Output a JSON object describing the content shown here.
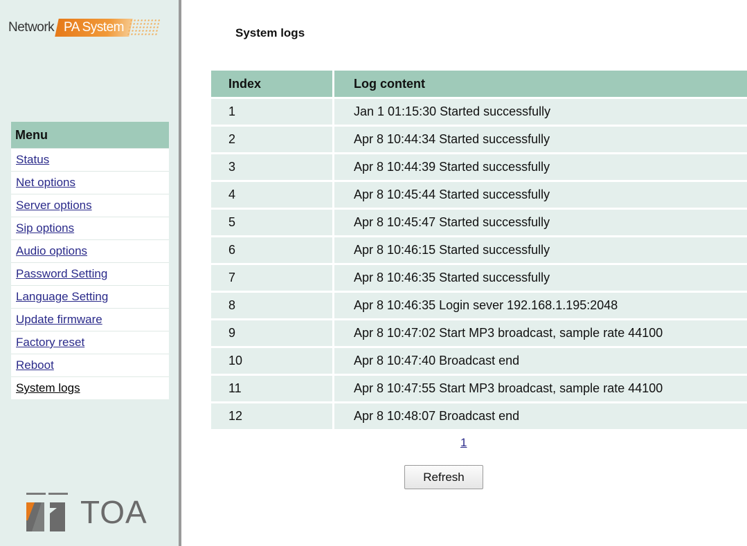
{
  "logo": {
    "word1": "Network",
    "word2": "PA System"
  },
  "brand": {
    "name": "TOA",
    "colors": {
      "accent": "#e67a1a",
      "header_green": "#9fcab9",
      "panel_bg": "#e4efec"
    }
  },
  "menu": {
    "header": "Menu",
    "items": [
      {
        "label": "Status"
      },
      {
        "label": "Net options"
      },
      {
        "label": "Server options"
      },
      {
        "label": "Sip options"
      },
      {
        "label": "Audio options"
      },
      {
        "label": "Password Setting"
      },
      {
        "label": "Language Setting"
      },
      {
        "label": "Update firmware"
      },
      {
        "label": "Factory reset"
      },
      {
        "label": "Reboot"
      },
      {
        "label": "System logs"
      }
    ]
  },
  "main": {
    "title": "System logs",
    "table": {
      "headers": [
        "Index",
        "Log content"
      ],
      "rows": [
        [
          "1",
          "Jan 1 01:15:30 Started successfully"
        ],
        [
          "2",
          "Apr 8 10:44:34 Started successfully"
        ],
        [
          "3",
          "Apr 8 10:44:39 Started successfully"
        ],
        [
          "4",
          "Apr 8 10:45:44 Started successfully"
        ],
        [
          "5",
          "Apr 8 10:45:47 Started successfully"
        ],
        [
          "6",
          "Apr 8 10:46:15 Started successfully"
        ],
        [
          "7",
          "Apr 8 10:46:35 Started successfully"
        ],
        [
          "8",
          "Apr 8 10:46:35 Login sever 192.168.1.195:2048"
        ],
        [
          "9",
          "Apr 8 10:47:02 Start MP3 broadcast, sample rate 44100"
        ],
        [
          "10",
          "Apr 8 10:47:40 Broadcast end"
        ],
        [
          "11",
          "Apr 8 10:47:55 Start MP3 broadcast, sample rate 44100"
        ],
        [
          "12",
          "Apr 8 10:48:07 Broadcast end"
        ]
      ]
    },
    "pager": "1",
    "refresh_label": "Refresh"
  }
}
